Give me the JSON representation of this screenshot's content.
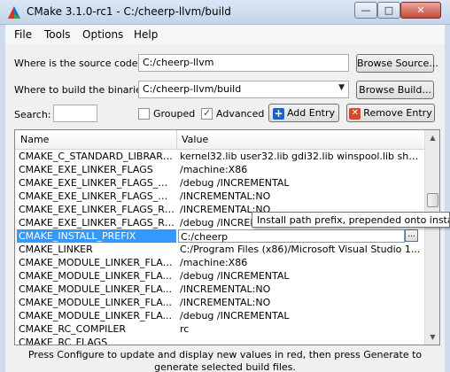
{
  "window": {
    "title": "CMake 3.1.0-rc1 - C:/cheerp-llvm/build",
    "minimize_glyph": "—",
    "maximize_glyph": "□",
    "close_glyph": "✕"
  },
  "menu": [
    "File",
    "Tools",
    "Options",
    "Help"
  ],
  "source": {
    "label": "Where is the source code:",
    "value": "C:/cheerp-llvm",
    "browse_label": "Browse Source..."
  },
  "build": {
    "label": "Where to build the binaries:",
    "value": "C:/cheerp-llvm/build",
    "browse_label": "Browse Build..."
  },
  "search": {
    "label": "Search:",
    "value": ""
  },
  "options": {
    "grouped_label": "Grouped",
    "grouped_checked": false,
    "advanced_label": "Advanced",
    "advanced_checked": true
  },
  "actions": {
    "add_entry_label": "Add Entry",
    "remove_entry_label": "Remove Entry"
  },
  "table": {
    "headers": {
      "name": "Name",
      "value": "Value"
    },
    "rows": [
      {
        "name": "CMAKE_C_STANDARD_LIBRARIES",
        "value": "kernel32.lib user32.lib gdi32.lib winspool.lib shell..."
      },
      {
        "name": "CMAKE_EXE_LINKER_FLAGS",
        "value": " /machine:X86"
      },
      {
        "name": "CMAKE_EXE_LINKER_FLAGS_DE...",
        "value": "/debug /INCREMENTAL"
      },
      {
        "name": "CMAKE_EXE_LINKER_FLAGS_MI...",
        "value": "/INCREMENTAL:NO"
      },
      {
        "name": "CMAKE_EXE_LINKER_FLAGS_RE...",
        "value": "/INCREMENTAL:NO"
      },
      {
        "name": "CMAKE_EXE_LINKER_FLAGS_RE...",
        "value": "/debug /INCREMENTAL"
      },
      {
        "name": "CMAKE_INSTALL_PREFIX",
        "value": "C:/cheerp",
        "selected": true
      },
      {
        "name": "CMAKE_LINKER",
        "value": "C:/Program Files (x86)/Microsoft Visual Studio 1..."
      },
      {
        "name": "CMAKE_MODULE_LINKER_FLAGS",
        "value": " /machine:X86"
      },
      {
        "name": "CMAKE_MODULE_LINKER_FLA...",
        "value": "/debug /INCREMENTAL"
      },
      {
        "name": "CMAKE_MODULE_LINKER_FLA...",
        "value": "/INCREMENTAL:NO"
      },
      {
        "name": "CMAKE_MODULE_LINKER_FLA...",
        "value": "/INCREMENTAL:NO"
      },
      {
        "name": "CMAKE_MODULE_LINKER_FLA...",
        "value": "/debug /INCREMENTAL"
      },
      {
        "name": "CMAKE_RC_COMPILER",
        "value": "rc"
      },
      {
        "name": "CMAKE_RC_FLAGS",
        "value": ""
      }
    ],
    "edit_button_label": "...",
    "scroll_up_glyph": "▲",
    "scroll_down_glyph": "▼",
    "scroll_position": 0.28
  },
  "tooltip": "Install path prefix, prepended onto install",
  "status": "Press Configure to update and display new values in red, then press Generate to generate selected build files.",
  "colors": {
    "selection": "#3399ff",
    "add_icon": "#1f5fbf",
    "remove_icon": "#d04a2a"
  }
}
